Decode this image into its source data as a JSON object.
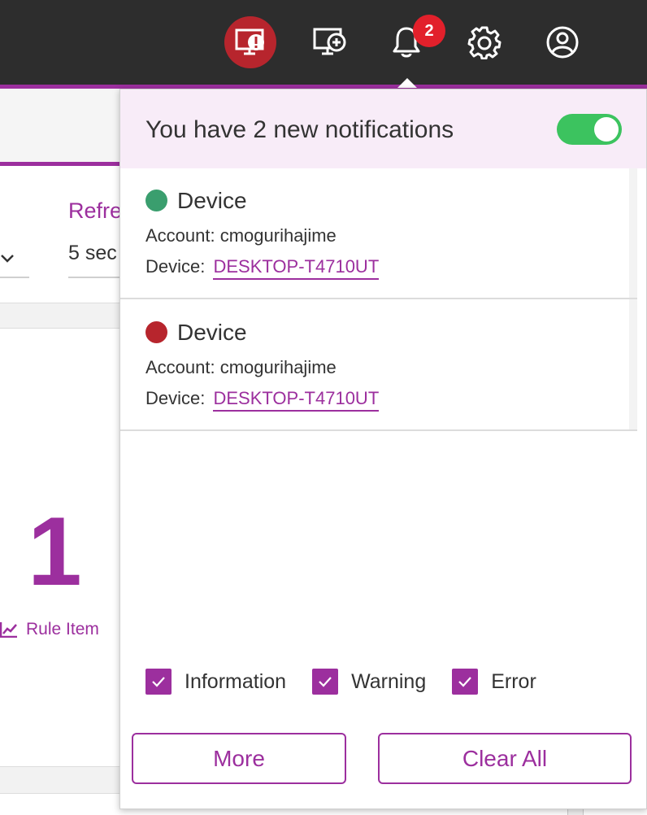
{
  "topbar": {
    "icons": [
      "monitor-alert-icon",
      "monitor-add-icon",
      "bell-icon",
      "gear-icon",
      "user-icon"
    ],
    "notification_count": "2",
    "alert_color": "#b7252d",
    "badge_color": "#e2202b",
    "accent": "#9c2f9e"
  },
  "background": {
    "refresh_label": "Refre",
    "refresh_value": "5 sec",
    "big_number": "1",
    "rule_link": "Rule Item"
  },
  "panel": {
    "title": "You have 2 new notifications",
    "toggle_on": true,
    "notifications": [
      {
        "status": "success",
        "status_color": "#3a9e6e",
        "title": "Device",
        "account": "Account: cmogurihajime",
        "device_label": "Device:",
        "device_link": "DESKTOP-T4710UT"
      },
      {
        "status": "error",
        "status_color": "#b7252d",
        "title": "Device",
        "account": "Account: cmogurihajime",
        "device_label": "Device:",
        "device_link": "DESKTOP-T4710UT"
      }
    ],
    "filters": [
      {
        "label": "Information",
        "checked": true
      },
      {
        "label": "Warning",
        "checked": true
      },
      {
        "label": "Error",
        "checked": true
      }
    ],
    "more_label": "More",
    "clear_label": "Clear All"
  }
}
